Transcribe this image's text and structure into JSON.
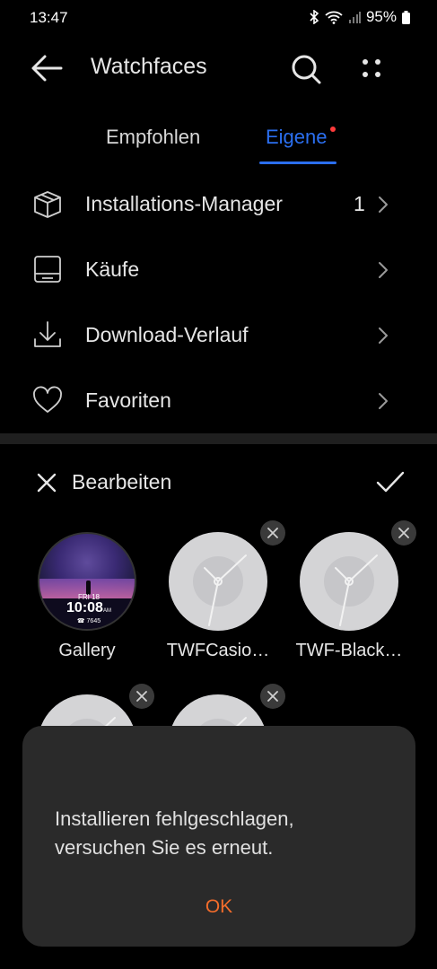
{
  "status_bar": {
    "time": "13:47",
    "battery": "95%"
  },
  "app_bar": {
    "title": "Watchfaces"
  },
  "tabs": [
    {
      "label": "Empfohlen"
    },
    {
      "label": "Eigene"
    }
  ],
  "menu": [
    {
      "label": "Installations-Manager",
      "count": "1",
      "icon": "box-icon"
    },
    {
      "label": "Käufe",
      "icon": "bag-icon"
    },
    {
      "label": "Download-Verlauf",
      "icon": "download-icon"
    },
    {
      "label": "Favoriten",
      "icon": "heart-icon"
    }
  ],
  "edit": {
    "label": "Bearbeiten"
  },
  "faces": [
    {
      "label": "Gallery",
      "date": "FRI 18",
      "time": "10:08",
      "ampm": "AM",
      "steps": "☎ 7645"
    },
    {
      "label": "TWFCasio…"
    },
    {
      "label": "TWF-Black…"
    },
    {
      "label": ""
    },
    {
      "label": ""
    }
  ],
  "dialog": {
    "message": "Installieren fehlgeschlagen, versuchen Sie es erneut.",
    "ok": "OK"
  },
  "colors": {
    "accent": "#2b6ff0",
    "ok": "#f26c2b",
    "dot": "#ff3b3b"
  }
}
